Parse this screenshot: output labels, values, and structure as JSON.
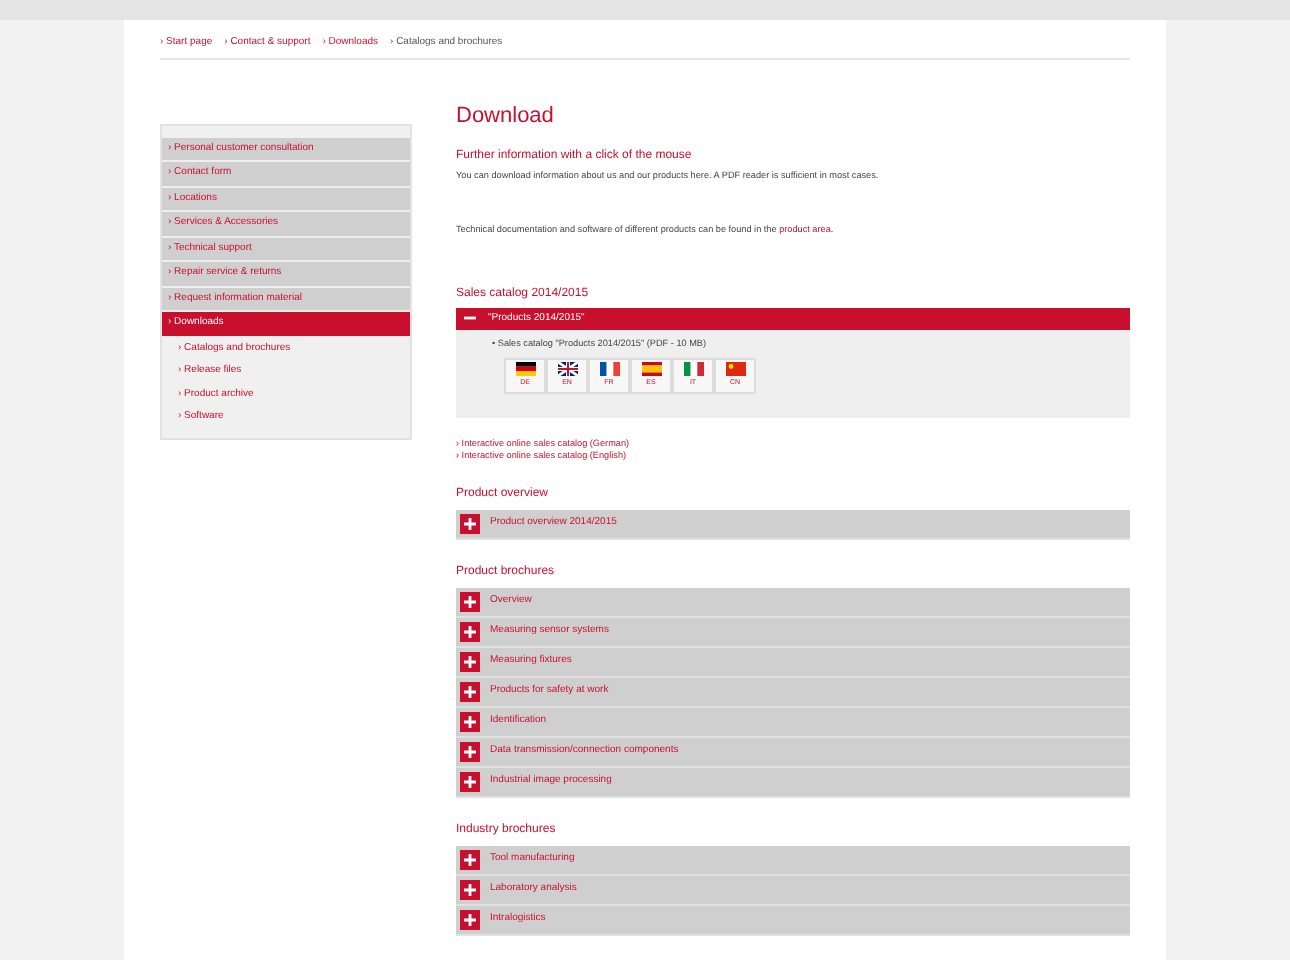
{
  "breadcrumb": [
    {
      "label": "› Start page",
      "current": false
    },
    {
      "label": "› Contact & support",
      "current": false
    },
    {
      "label": "› Downloads",
      "current": false
    },
    {
      "label": "› Catalogs and brochures",
      "current": true
    }
  ],
  "sidebar": {
    "items": [
      {
        "label": "› Personal customer consultation",
        "selected": false
      },
      {
        "label": "› Contact form",
        "selected": false
      },
      {
        "label": "› Locations",
        "selected": false
      },
      {
        "label": "› Services & Accessories",
        "selected": false
      },
      {
        "label": "› Technical support",
        "selected": false
      },
      {
        "label": "› Repair service & returns",
        "selected": false
      },
      {
        "label": "› Request information material",
        "selected": false
      },
      {
        "label": "› Downloads",
        "selected": true,
        "children": [
          {
            "label": "› Catalogs and brochures",
            "selected": false
          },
          {
            "label": "› Release files",
            "selected": false
          },
          {
            "label": "› Product archive",
            "selected": false
          },
          {
            "label": "› Software",
            "selected": false
          }
        ]
      }
    ]
  },
  "main": {
    "title": "Download",
    "subtitle": "Further information with a click of the mouse",
    "intro": "You can download information about us and our products here. A PDF reader is sufficient in most cases.",
    "note": {
      "before": "Technical documentation and software of different products can be found in the",
      "link": "product area",
      "after": "."
    },
    "sales_catalog": {
      "heading": "Sales catalog 2014/2015",
      "panel": {
        "title": "\"Products 2014/2015\"",
        "expanded": true,
        "item": "• Sales catalog \"Products 2014/2015\" (PDF - 10 MB)",
        "flags": [
          {
            "kind": "de",
            "code": "DE"
          },
          {
            "kind": "gb",
            "code": "EN"
          },
          {
            "kind": "fr",
            "code": "FR"
          },
          {
            "kind": "es",
            "code": "ES"
          },
          {
            "kind": "it",
            "code": "IT"
          },
          {
            "kind": "cn",
            "code": "CN"
          }
        ]
      }
    },
    "online_links": [
      "› Interactive online sales catalog (German)",
      "› Interactive online sales catalog (English)"
    ],
    "sections": [
      {
        "heading": "Product overview",
        "items": [
          {
            "label": "Product overview 2014/2015",
            "expanded": false
          }
        ]
      },
      {
        "heading": "Product brochures",
        "items": [
          {
            "label": "Overview",
            "expanded": false
          },
          {
            "label": "Measuring sensor systems",
            "expanded": false
          },
          {
            "label": "Measuring fixtures",
            "expanded": false
          },
          {
            "label": "Products for safety at work",
            "expanded": false
          },
          {
            "label": "Identification",
            "expanded": false
          },
          {
            "label": "Data transmission/connection components",
            "expanded": false
          },
          {
            "label": "Industrial image processing",
            "expanded": false
          }
        ]
      },
      {
        "heading": "Industry brochures",
        "items": [
          {
            "label": "Tool manufacturing",
            "expanded": false
          },
          {
            "label": "Laboratory analysis",
            "expanded": false
          },
          {
            "label": "Intralogistics",
            "expanded": false
          }
        ]
      }
    ]
  }
}
